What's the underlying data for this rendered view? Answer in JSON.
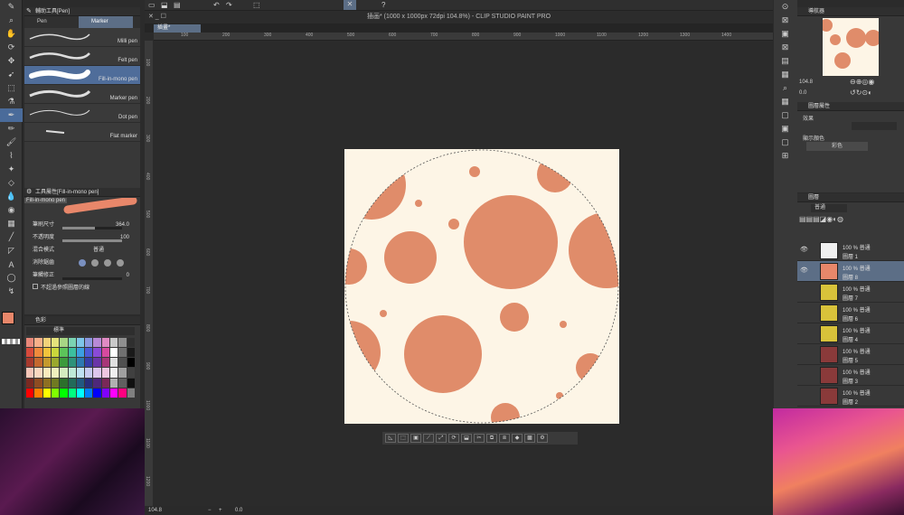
{
  "window_title": "插画* (1000 x 1000px 72dpi 104.8%) - CLIP STUDIO PAINT PRO",
  "doc_tab": "插畫*",
  "zoom": "104.8",
  "rotation": "0.0",
  "rulers_top": [
    "100",
    "200",
    "300",
    "400",
    "500",
    "600",
    "700",
    "800",
    "900",
    "1000",
    "1100",
    "1200",
    "1300",
    "1400"
  ],
  "rulers_left": [
    "100",
    "200",
    "300",
    "400",
    "500",
    "600",
    "700",
    "800",
    "900",
    "1000",
    "1100",
    "1200"
  ],
  "subtool": {
    "title": "輔助工具[Pen]",
    "tabs": [
      "Pen",
      "Marker"
    ],
    "brushes": [
      "Milli pen",
      "Felt pen",
      "Fill-in-mono pen",
      "Marker pen",
      "Dot pen",
      "Flat marker"
    ],
    "selected": 2
  },
  "toolprop": {
    "title": "工具屬性[Fill-in-mono pen]",
    "brush_name": "Fill-in-mono pen",
    "rows": [
      {
        "label": "筆刷尺寸",
        "value": "364.0",
        "fill": 0.55
      },
      {
        "label": "不透明度",
        "value": "100",
        "fill": 1.0
      },
      {
        "label": "混合模式",
        "value": "普通"
      },
      {
        "label": "消除鋸齒"
      },
      {
        "label": "筆觸修正",
        "value": "0",
        "fill": 0.0
      }
    ],
    "checkbox_label": "不超過參照圖層的線"
  },
  "colorpanel": {
    "title": "色彩",
    "set_label": "標準",
    "colors": [
      "#e8887a",
      "#f7b08a",
      "#f2d27a",
      "#e4e27c",
      "#a7d685",
      "#7bd4b3",
      "#7ec5e8",
      "#8b98e0",
      "#b88ad6",
      "#e08ac3",
      "#c9c9c9",
      "#8f8f8f",
      "#2f2f2f",
      "#d64a3c",
      "#f08a3c",
      "#f2c43c",
      "#c9d63c",
      "#5cc45a",
      "#3cbf9e",
      "#3c9ee0",
      "#4c5ad6",
      "#8a4ad6",
      "#d64a9e",
      "#ffffff",
      "#707070",
      "#1a1a1a",
      "#a63a2e",
      "#c4682e",
      "#c49a2e",
      "#9aa82e",
      "#3c9a3c",
      "#2e927a",
      "#2e78b0",
      "#363ea8",
      "#6a36a8",
      "#a83678",
      "#e0e0e0",
      "#505050",
      "#000000",
      "#f5c6b8",
      "#fad8c0",
      "#faeabd",
      "#f0f0bd",
      "#d4ecc0",
      "#bfead8",
      "#bfe2f2",
      "#c6cbef",
      "#dcc6ec",
      "#efc6e0",
      "#f0f0f0",
      "#a0a0a0",
      "#404040",
      "#7a2a22",
      "#8e4c22",
      "#8e7022",
      "#707a22",
      "#2c702c",
      "#226a5a",
      "#225880",
      "#282e7a",
      "#4e287a",
      "#7a2858",
      "#b0b0b0",
      "#606060",
      "#101010",
      "#ff0000",
      "#ff8000",
      "#ffff00",
      "#80ff00",
      "#00ff00",
      "#00ff80",
      "#00ffff",
      "#0080ff",
      "#0000ff",
      "#8000ff",
      "#ff00ff",
      "#ff0080",
      "#808080"
    ]
  },
  "main_color": "#e8876a",
  "layer_props": {
    "title": "圖層屬性",
    "effect_label": "效果",
    "display_color_label": "顯示顏色",
    "color_mode": "彩色"
  },
  "navigator": {
    "title": "導航器",
    "zoom": "104.8",
    "angle": "0.0"
  },
  "layers_panel": {
    "title": "圖層",
    "blend_mode": "普通",
    "layers": [
      {
        "opacity": "100 %",
        "mode": "普通",
        "name": "圖層 1",
        "thumb": "#f0f0f0"
      },
      {
        "opacity": "100 %",
        "mode": "普通",
        "name": "圖層 8",
        "thumb": "#e8876a",
        "selected": true
      },
      {
        "opacity": "100 %",
        "mode": "普通",
        "name": "圖層 7",
        "thumb": "#d8c23a"
      },
      {
        "opacity": "100 %",
        "mode": "普通",
        "name": "圖層 6",
        "thumb": "#d8c23a"
      },
      {
        "opacity": "100 %",
        "mode": "普通",
        "name": "圖層 4",
        "thumb": "#d8c23a"
      },
      {
        "opacity": "100 %",
        "mode": "普通",
        "name": "圖層 5",
        "thumb": "#8a3a3a"
      },
      {
        "opacity": "100 %",
        "mode": "普通",
        "name": "圖層 3",
        "thumb": "#8a3a3a"
      },
      {
        "opacity": "100 %",
        "mode": "普通",
        "name": "圖層 2",
        "thumb": "#8a3a3a"
      }
    ]
  },
  "dots_color": "#e08c6a",
  "canvas_bg": "#fdf5e6"
}
